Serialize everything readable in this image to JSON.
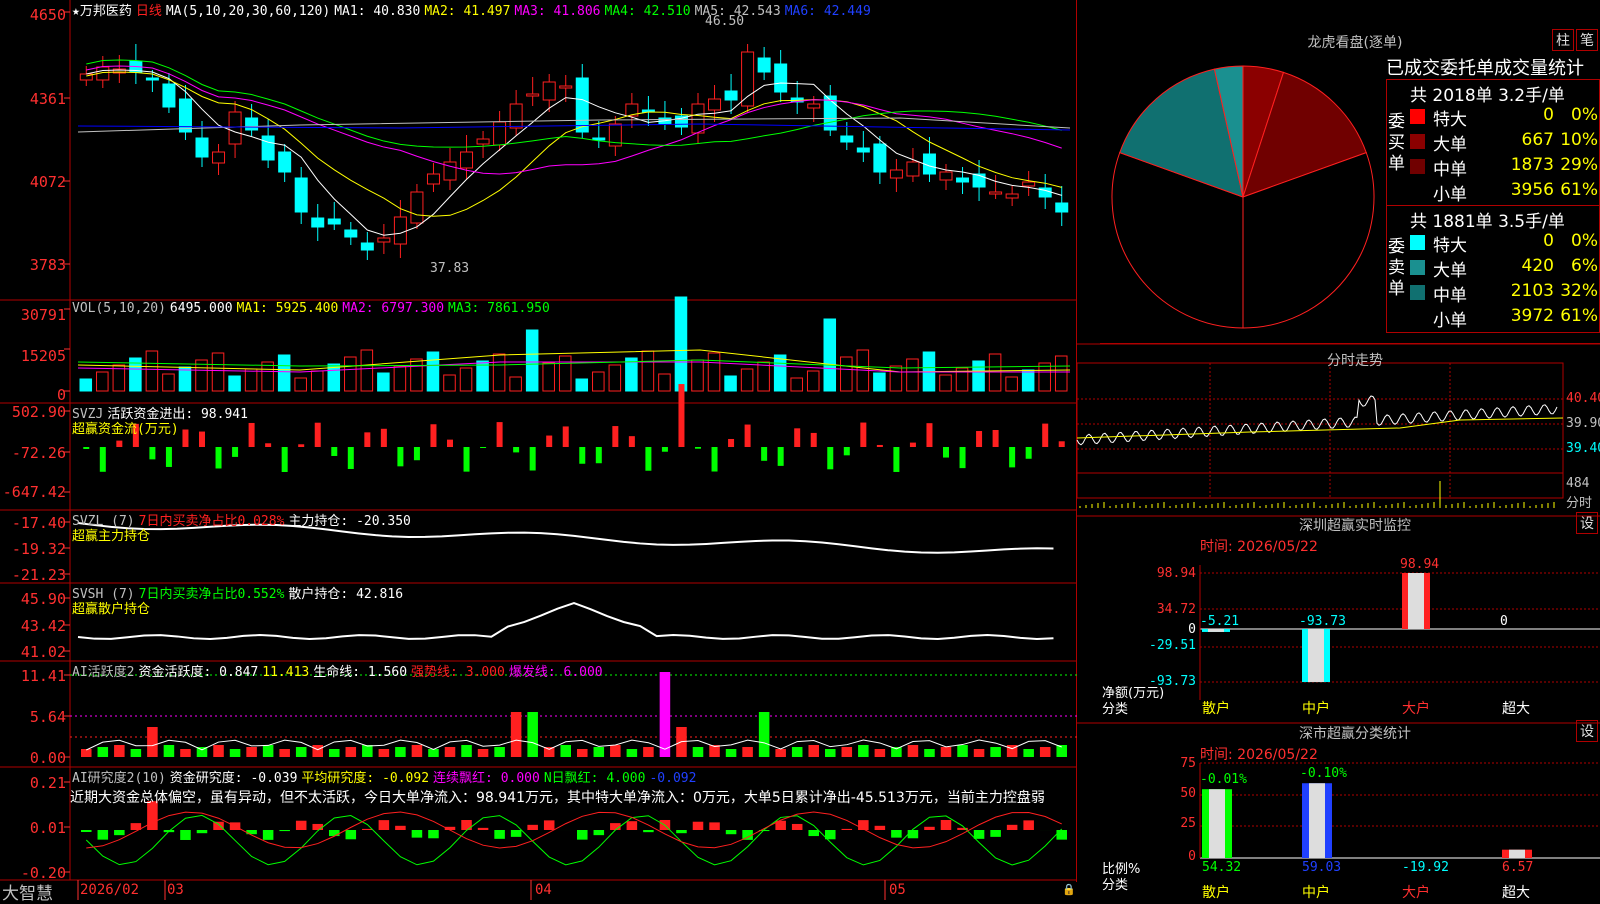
{
  "colors": {
    "up": "#ff2020",
    "down": "#00ffff",
    "ma1": "#ffffff",
    "ma2": "#ffff00",
    "ma3": "#ff00ff",
    "ma4": "#00ff00",
    "ma5": "#c0c0c0",
    "ma6": "#0000ff",
    "border": "#b00000",
    "frame_text": "#c0c0c0"
  },
  "header": {
    "title": "★万邦医药",
    "period": "日线",
    "ma_params": "MA(5,10,20,30,60,120)",
    "ma1": "MA1: 40.830",
    "ma2": "MA2: 41.497",
    "ma3": "MA3: 41.806",
    "ma4": "MA4: 42.510",
    "ma5": "MA5: 42.543",
    "ma6": "MA6: 42.449"
  },
  "price_axis": [
    "4650",
    "4361",
    "4072",
    "3783"
  ],
  "annotations": {
    "high": "46.50",
    "low": "37.83"
  },
  "volume": {
    "axis": [
      "30791",
      "15205",
      "0"
    ],
    "label": "VOL(5,10,20)",
    "value": "6495.000",
    "ma1": "MA1: 5925.400",
    "ma2": "MA2: 6797.300",
    "ma3": "MA3: 7861.950"
  },
  "svzj": {
    "axis": [
      "502.90",
      "-72.26",
      "-647.42"
    ],
    "name": "SVZJ",
    "label": "活跃资金进出: 98.941",
    "sub": "超赢资金流(万元)"
  },
  "svzl": {
    "axis": [
      "-17.40",
      "-19.32",
      "-21.23"
    ],
    "name": "SVZL (7)",
    "label1": "7日内买卖净占比0.028%",
    "label2": "主力持仓: -20.350",
    "sub": "超赢主力持仓"
  },
  "svsh": {
    "axis": [
      "45.90",
      "43.42",
      "41.02"
    ],
    "name": "SVSH (7)",
    "label1": "7日内买卖净占比0.552%",
    "label2": "散户持仓: 42.816",
    "sub": "超赢散户持仓"
  },
  "ai_active": {
    "axis": [
      "11.41",
      "5.64",
      "0.00"
    ],
    "name": "AI活跃度2",
    "label1": "资金活跃度: 0.847",
    "label2": "11.413",
    "label3": "生命线: 1.560",
    "label4": "强势线: 3.000",
    "label5": "爆发线: 6.000"
  },
  "ai_research": {
    "axis": [
      "0.21",
      "0.01",
      "-0.20"
    ],
    "name": "AI研究度2(10)",
    "label1": "资金研究度: -0.039",
    "label2": "平均研究度: -0.092",
    "label3": "连续飘红: 0.000",
    "label4": "N日飘红: 4.000",
    "label5": "-0.092",
    "desc": "近期大资金总体偏空，虽有异动，但不太活跃，今日大单净流入：98.941万元，其中特大单净流入：0万元，大单5日累计净出-45.513万元，当前主力控盘弱"
  },
  "bottom_bar": {
    "brand": "大智慧",
    "date": "2026/02",
    "m03": "03",
    "m04": "04",
    "m05": "05"
  },
  "dragon": {
    "title": "龙虎看盘(逐单)",
    "btn1": "柱",
    "btn2": "笔",
    "stats_title": "已成交委托单成交量统计",
    "buy_header": "共 2018单 3.2手/单",
    "buy_label": "委买单",
    "buy_rows": [
      {
        "name": "特大",
        "count": "0",
        "pct": "0%",
        "color": "#ff0000"
      },
      {
        "name": "大单",
        "count": "667",
        "pct": "10%",
        "color": "#8b0000"
      },
      {
        "name": "中单",
        "count": "1873",
        "pct": "29%",
        "color": "#700000"
      },
      {
        "name": "小单",
        "count": "3956",
        "pct": "61%",
        "color": "#000000"
      }
    ],
    "sell_header": "共 1881单 3.5手/单",
    "sell_label": "委卖单",
    "sell_rows": [
      {
        "name": "特大",
        "count": "0",
        "pct": "0%",
        "color": "#00ffff"
      },
      {
        "name": "大单",
        "count": "420",
        "pct": "6%",
        "color": "#1a9090"
      },
      {
        "name": "中单",
        "count": "2103",
        "pct": "32%",
        "color": "#107070"
      },
      {
        "name": "小单",
        "count": "3972",
        "pct": "61%",
        "color": "#000000"
      }
    ]
  },
  "intraday": {
    "title": "分时走势",
    "axis": [
      "40.40",
      "39.90",
      "39.40"
    ],
    "vol_axis": "484",
    "vol_label": "分时"
  },
  "sz_monitor": {
    "title": "深圳超赢实时监控",
    "btn": "设",
    "time": "时间: 2026/05/22",
    "axis": [
      "98.94",
      "34.72",
      "0",
      "-29.51",
      "-93.73"
    ],
    "ylabel": "净额(万元)",
    "xlabel": "分类",
    "categories": [
      "散户",
      "中户",
      "大户",
      "超大"
    ],
    "values_text": [
      "-5.21",
      "-93.73",
      "98.94",
      "0"
    ]
  },
  "classify": {
    "title": "深市超赢分类统计",
    "btn": "设",
    "time": "时间: 2026/05/22",
    "axis": [
      "75",
      "50",
      "25",
      "0"
    ],
    "ylabel": "比例%",
    "xlabel": "分类",
    "categories": [
      "散户",
      "中户",
      "大户",
      "超大"
    ],
    "top_labels": [
      "-0.01%",
      "-0.10%"
    ],
    "bottom_values": [
      "54.32",
      "59.03",
      "-19.92",
      "6.57"
    ]
  }
}
